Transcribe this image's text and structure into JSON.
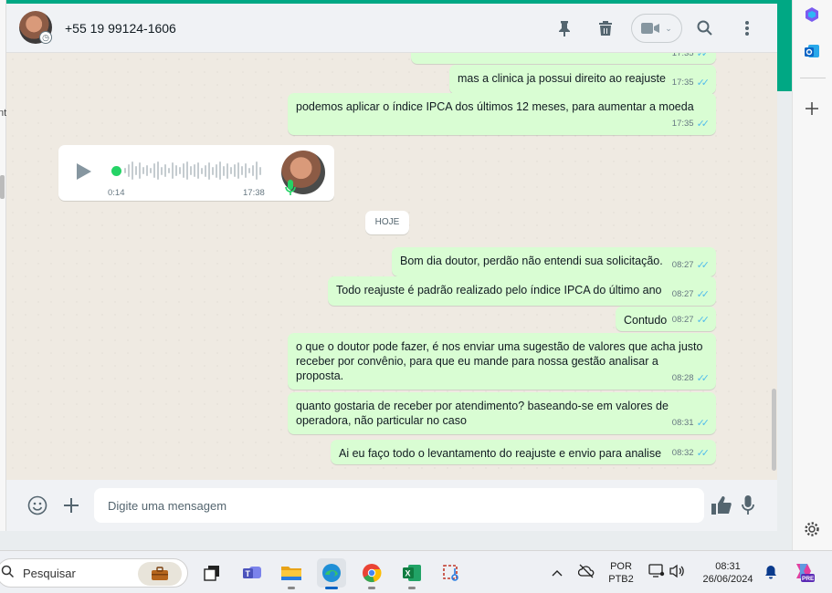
{
  "left_window": {
    "fragment": "nt"
  },
  "header": {
    "contact_name": "+55 19 99124-1606",
    "icons": [
      "pin-icon",
      "trash-icon",
      "video-call-icon",
      "search-icon",
      "menu-dots-icon"
    ]
  },
  "messages": [
    {
      "text": "mas a clinica ja possui direito ao reajuste",
      "time": "17:35"
    },
    {
      "text": "podemos aplicar o índice IPCA dos últimos 12 meses, para aumentar a moeda",
      "time": "17:35"
    },
    {
      "text": "Bom dia doutor, perdão não entendi sua solicitação.",
      "time": "08:27"
    },
    {
      "text": "Todo reajuste é padrão realizado pelo índice IPCA do último ano",
      "time": "08:27"
    },
    {
      "text": "Contudo",
      "time": "08:27"
    },
    {
      "text": "o que o doutor pode fazer, é nos enviar uma sugestão de valores que acha justo receber por convênio, para que eu mande para nossa gestão analisar a proposta.",
      "time": "08:28"
    },
    {
      "text": "quanto gostaria de receber por atendimento? baseando-se em valores de operadora, não particular no caso",
      "time": "08:31"
    },
    {
      "text": "Ai eu faço todo o levantamento do reajuste e envio para analise",
      "time": "08:32"
    }
  ],
  "partial_time": "17:35",
  "audio": {
    "duration": "0:14",
    "time": "17:38"
  },
  "day_divider": "HOJE",
  "composer": {
    "placeholder": "Digite uma mensagem"
  },
  "taskbar": {
    "search_label": "Pesquisar",
    "lang_line1": "POR",
    "lang_line2": "PTB2",
    "clock_time": "08:31",
    "clock_date": "26/06/2024",
    "copilot_badge": "PRE"
  },
  "colors": {
    "accent": "#00a884",
    "outgoing_bubble": "#d9fdd3",
    "read_ticks": "#53bdeb",
    "chat_bg": "#efeae2"
  }
}
